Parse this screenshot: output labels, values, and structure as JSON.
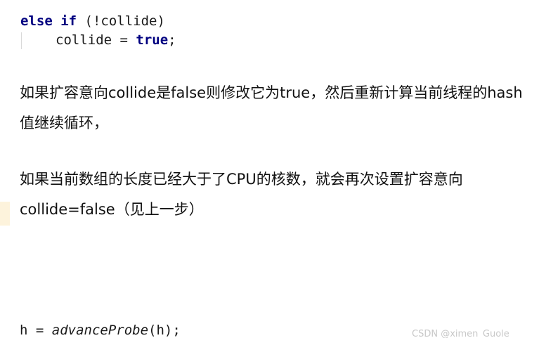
{
  "code_top": {
    "line1": {
      "kw_else": "else",
      "kw_if": "if",
      "rest": " (!collide)"
    },
    "line2": {
      "lhs": "collide = ",
      "kw_true": "true",
      "end": ";"
    }
  },
  "paragraphs": [
    "如果扩容意向collide是false则修改它为true，然后重新计算当前线程的hash值继续循环，",
    "如果当前数组的长度已经大于了CPU的核数，就会再次设置扩容意向collide=false（见上一步）"
  ],
  "code_bottom": {
    "lhs": "h = ",
    "fn": "advanceProbe",
    "args": "(h);"
  },
  "watermark": "CSDN @ximen_Guole"
}
